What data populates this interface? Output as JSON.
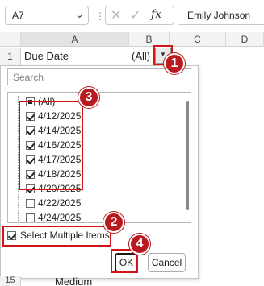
{
  "formula_bar": {
    "name_box": "A7",
    "fx_label": "fx",
    "formula_value": "Emily Johnson"
  },
  "columns": [
    "A",
    "B",
    "C",
    "D"
  ],
  "rows": {
    "row1_num": "1",
    "row1_a": "Due Date",
    "row1_b": "(All)",
    "row15_num": "15",
    "row15_a": "Medium"
  },
  "filter": {
    "search_placeholder": "Search",
    "items": [
      {
        "label": "(All)",
        "state": "partial"
      },
      {
        "label": "4/12/2025",
        "state": "checked"
      },
      {
        "label": "4/14/2025",
        "state": "checked"
      },
      {
        "label": "4/16/2025",
        "state": "checked"
      },
      {
        "label": "4/17/2025",
        "state": "checked"
      },
      {
        "label": "4/18/2025",
        "state": "checked"
      },
      {
        "label": "4/20/2025",
        "state": "checked"
      },
      {
        "label": "4/22/2025",
        "state": "unchecked"
      },
      {
        "label": "4/24/2025",
        "state": "unchecked"
      }
    ],
    "select_multiple_label": "Select Multiple Items",
    "select_multiple_checked": true,
    "ok_label": "OK",
    "cancel_label": "Cancel"
  },
  "callouts": [
    "1",
    "2",
    "3",
    "4"
  ],
  "colors": {
    "callout": "#b91a1f",
    "highlight": "#d0141a"
  }
}
